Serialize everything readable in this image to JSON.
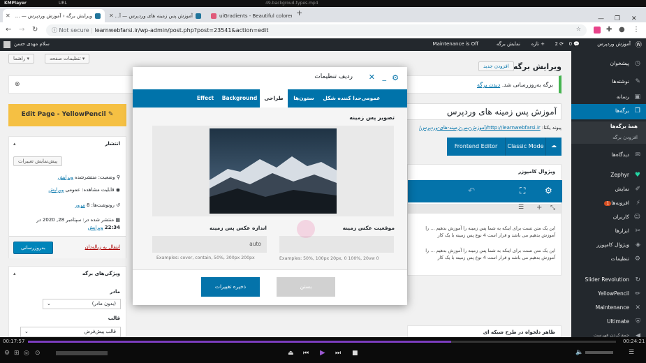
{
  "kmp": {
    "logo": "KMPlayer",
    "url": "URL",
    "file": "49-backgroud-types.mp4"
  },
  "tabs": [
    {
      "title": "ویرایش برگه ‹ آموزش وردپرس — ...",
      "color": "#21759b"
    },
    {
      "title": "آموزش پس زمینه های وردپرس — آ...",
      "color": "#21759b"
    },
    {
      "title": "uiGradients - Beautiful colored ...",
      "color": "#e05a7a"
    }
  ],
  "address": {
    "not_secure": "Not secure",
    "url": "learnwebfarsi.ir/wp-admin/post.php?post=23541&action=edit"
  },
  "adminbar": {
    "site": "آموزش وردپرس",
    "comments": "0",
    "updates": "2",
    "new": "+ تازه",
    "view": "نمایش برگه",
    "maintenance": "Maintenance is Off",
    "greeting": "سلام مهدی حسن"
  },
  "menu": {
    "dashboard": "پیشخوان",
    "posts": "نوشته‌ها",
    "media": "رسانه",
    "pages": "برگه‌ها",
    "all_pages": "همهٔ برگه‌ها",
    "add_page": "افزودن برگه",
    "comments": "دیدگاه‌ها",
    "zephyr": "Zephyr",
    "appearance": "نمایش",
    "plugins": "افزونه‌ها",
    "plugins_badge": "1",
    "users": "کاربران",
    "tools": "ابزارها",
    "composer": "ویژوال کامپوزر",
    "settings": "تنظیمات",
    "slider": "Slider Revolution",
    "yellowpencil": "YellowPencil",
    "maintenance": "Maintenance",
    "ultimate": "Ultimate",
    "collapse": "جمع کردن فهرست"
  },
  "page": {
    "title": "ویرایش برگه",
    "add_new": "افزودن جدید",
    "screen_options": "تنظیمات صفحه",
    "help": "راهنما",
    "notice": "برگه به‌روزرسانی شد.",
    "notice_link": "دیدن برگه",
    "post_title": "آموزش پس زمینه های وردپرس",
    "permalink_label": "پیوند یکتا:",
    "permalink": "http://learnwebfarsi.ir/آموزش-پس-زمینه-های-وردپرس/",
    "frontend_editor": "Frontend Editor",
    "classic_mode": "Classic Mode",
    "composer_title": "ویژوال کامپوزر",
    "text1": "این یک متن تست برای اینکه به شما پس زمینه را آموزش بدهیم ... را آموزش بدهیم می باشد و قرار است 4 نوع پس زمینه با یک کار",
    "text2": "این یک متن تست برای اینکه به شما پس زمینه را آموزش بدهیم ... را آموزش بدهیم می باشد و قرار است 4 نوع پس زمینه با یک کار",
    "bottom_box": "ظاهر دلخواه در طرح شبکه ای",
    "yellowpencil": "Edit Page - YellowPencil",
    "publish": "انتشار",
    "preview": "پیش‌نمایش تغییرات",
    "status": "وضعیت: منتشرشده",
    "status_edit": "ویرایش",
    "visibility": "قابلیت مشاهده: عمومی",
    "visibility_edit": "ویرایش",
    "revisions": "رونوشت‌ها: 8",
    "revisions_link": "مرور",
    "published_on": "منتشر شده در: سپتامبر 28, 2020 در",
    "published_time": "22:34",
    "published_edit": "ویرایش",
    "trash": "انتقال به زباله‌دان",
    "update": "به‌روزرسانی",
    "attributes": "ویژگی‌های برگه",
    "parent": "مادر",
    "parent_value": "(بدون مادر)",
    "template": "قالب",
    "template_value": "قالب پیش‌فرض"
  },
  "modal": {
    "title": "ردیف تنظیمات",
    "tabs": [
      "عمومی",
      "حدا کننده شکل",
      "ستون‌ها",
      "طراحی",
      "Background",
      "Effect"
    ],
    "bg_image_label": "تصویر پس زمینه",
    "position_label": "موقعیت عکس زمینه",
    "position_value": "",
    "position_hint": "Examples: 50%, 100px 20px, 0 100%, 20vw 0",
    "size_label": "اندازه عکس پس زمینه",
    "size_value": "auto",
    "size_hint": "Examples: cover, contain, 50%, 300px 200px",
    "close_btn": "بستن",
    "save_btn": "ذخیره تغییرات"
  },
  "player": {
    "elapsed": "00:17:57",
    "total": "00:24:21",
    "progress": 0.72
  }
}
